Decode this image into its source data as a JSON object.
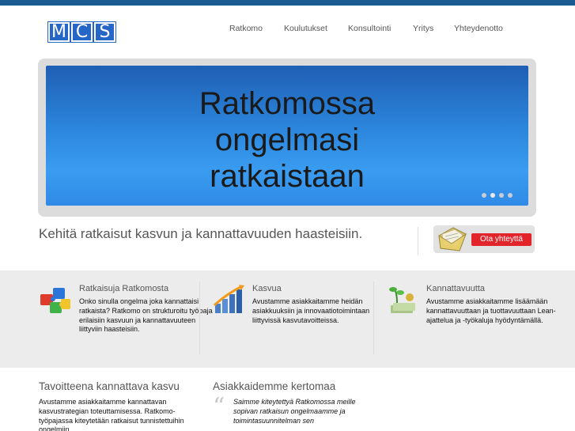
{
  "logo": {
    "letters": [
      "M",
      "C",
      "S"
    ]
  },
  "nav": {
    "items": [
      "Ratkomo",
      "Koulutukset",
      "Konsultointi",
      "Yritys",
      "Yhteydenotto"
    ]
  },
  "hero": {
    "lines": [
      "Ratkomossa",
      "ongelmasi",
      "ratkaistaan"
    ],
    "slide_count": 4,
    "active_slide": 1
  },
  "tagline": "Kehitä ratkaisut kasvun ja kannattavuuden haasteisiin.",
  "cta": {
    "label": "Ota yhteyttä",
    "icon": "envelope-icon"
  },
  "features": [
    {
      "title": "Ratkaisuja Ratkomosta",
      "icon": "puzzle-icon",
      "text": "Onko sinulla ongelma joka kannattaisi ratkaista? Ratkomo on strukturoitu työpaja erilaisiin kasvuun ja kannattavuuteen liittyviin haasteisiin."
    },
    {
      "title": "Kasvua",
      "icon": "growth-chart-icon",
      "text": "Avustamme asiakkaitamme heidän asiakkuuksiin ja innovaatiotoimintaan liittyvissä kasvutavoitteissa."
    },
    {
      "title": "Kannattavuutta",
      "icon": "money-plant-icon",
      "text": "Avustamme asiakkaitamme lisäämään kannattavuuttaan ja tuottavuuttaan Lean-ajattelua ja -työkaluja hyödyntämällä."
    }
  ],
  "bottom": {
    "left_title": "Tavoitteena kannattava kasvu",
    "left_text": "Avustamme asiakkaitamme kannattavan kasvustrategian toteuttamisessa. Ratkomo-työpajassa kiteytetään ratkaisut tunnistettuihin ongelmiin.",
    "right_title": "Asiakkaidemme kertomaa",
    "quote": "Saimme kiteytettyä Ratkomossa meille sopivan ratkaisun ongelmaamme ja toimintasuunnitelman sen"
  }
}
